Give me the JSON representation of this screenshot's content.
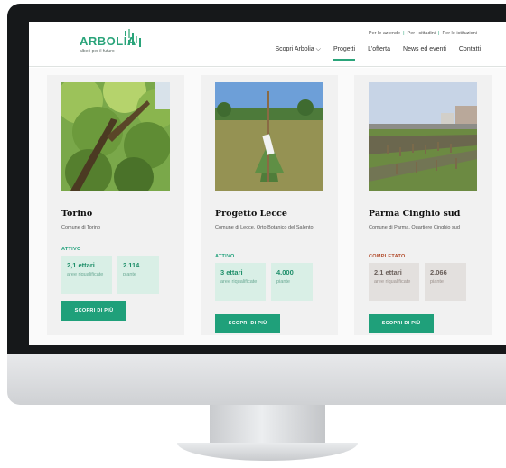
{
  "site": {
    "logo": "ARBOLIA",
    "logo_tagline": "alberi per il futuro"
  },
  "top_links": [
    "Per le aziende",
    "Per i cittadini",
    "Per le istituzioni"
  ],
  "nav": {
    "items": [
      "Scopri Arbolia",
      "Progetti",
      "L'offerta",
      "News ed eventi",
      "Contatti"
    ],
    "active": "Progetti"
  },
  "colors": {
    "accent": "#1fa07a",
    "completed": "#b14a2a"
  },
  "projects": [
    {
      "title": "Torino",
      "place": "Comune di Torino",
      "status": "ATTIVO",
      "stat1_value": "2,1 ettari",
      "stat1_label": "aree riqualificate",
      "stat2_value": "2.114",
      "stat2_label": "piante",
      "cta": "SCOPRI DI PIÙ"
    },
    {
      "title": "Progetto Lecce",
      "place": "Comune di Lecce, Orto Botanico del Salento",
      "status": "ATTIVO",
      "stat1_value": "3 ettari",
      "stat1_label": "aree riqualificate",
      "stat2_value": "4.000",
      "stat2_label": "piante",
      "cta": "SCOPRI DI PIÙ"
    },
    {
      "title": "Parma Cinghio sud",
      "place": "Comune di Parma, Quartiere Cinghio sud",
      "status": "COMPLETATO",
      "stat1_value": "2,1 ettari",
      "stat1_label": "aree riqualificate",
      "stat2_value": "2.066",
      "stat2_label": "piante",
      "cta": "SCOPRI DI PIÙ"
    }
  ]
}
